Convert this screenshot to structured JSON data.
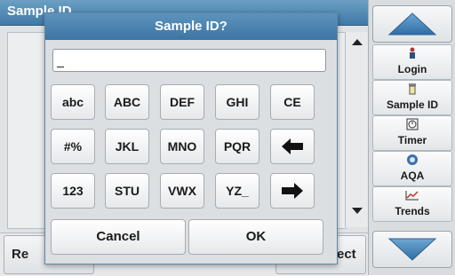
{
  "background": {
    "title": "Sample ID",
    "bottom_left_label": "Re",
    "bottom_right_label": "ect"
  },
  "sidebar": {
    "items": [
      {
        "label": "Login",
        "icon": "person-icon"
      },
      {
        "label": "Sample ID",
        "icon": "sample-vial-icon"
      },
      {
        "label": "Timer",
        "icon": "timer-icon"
      },
      {
        "label": "AQA",
        "icon": "aqa-icon"
      },
      {
        "label": "Trends",
        "icon": "trends-icon"
      }
    ]
  },
  "dialog": {
    "title": "Sample ID?",
    "input_value": "",
    "keys": [
      [
        "abc",
        "ABC",
        "DEF",
        "GHI",
        "CE"
      ],
      [
        "#%",
        "JKL",
        "MNO",
        "PQR",
        "backspace-arrow"
      ],
      [
        "123",
        "STU",
        "VWX",
        "YZ_",
        "forward-arrow"
      ]
    ],
    "cancel_label": "Cancel",
    "ok_label": "OK"
  },
  "colors": {
    "title_bar": "#3c76a3",
    "panel": "#dcdfe2",
    "arrow_blue": "#3f7fb7"
  }
}
